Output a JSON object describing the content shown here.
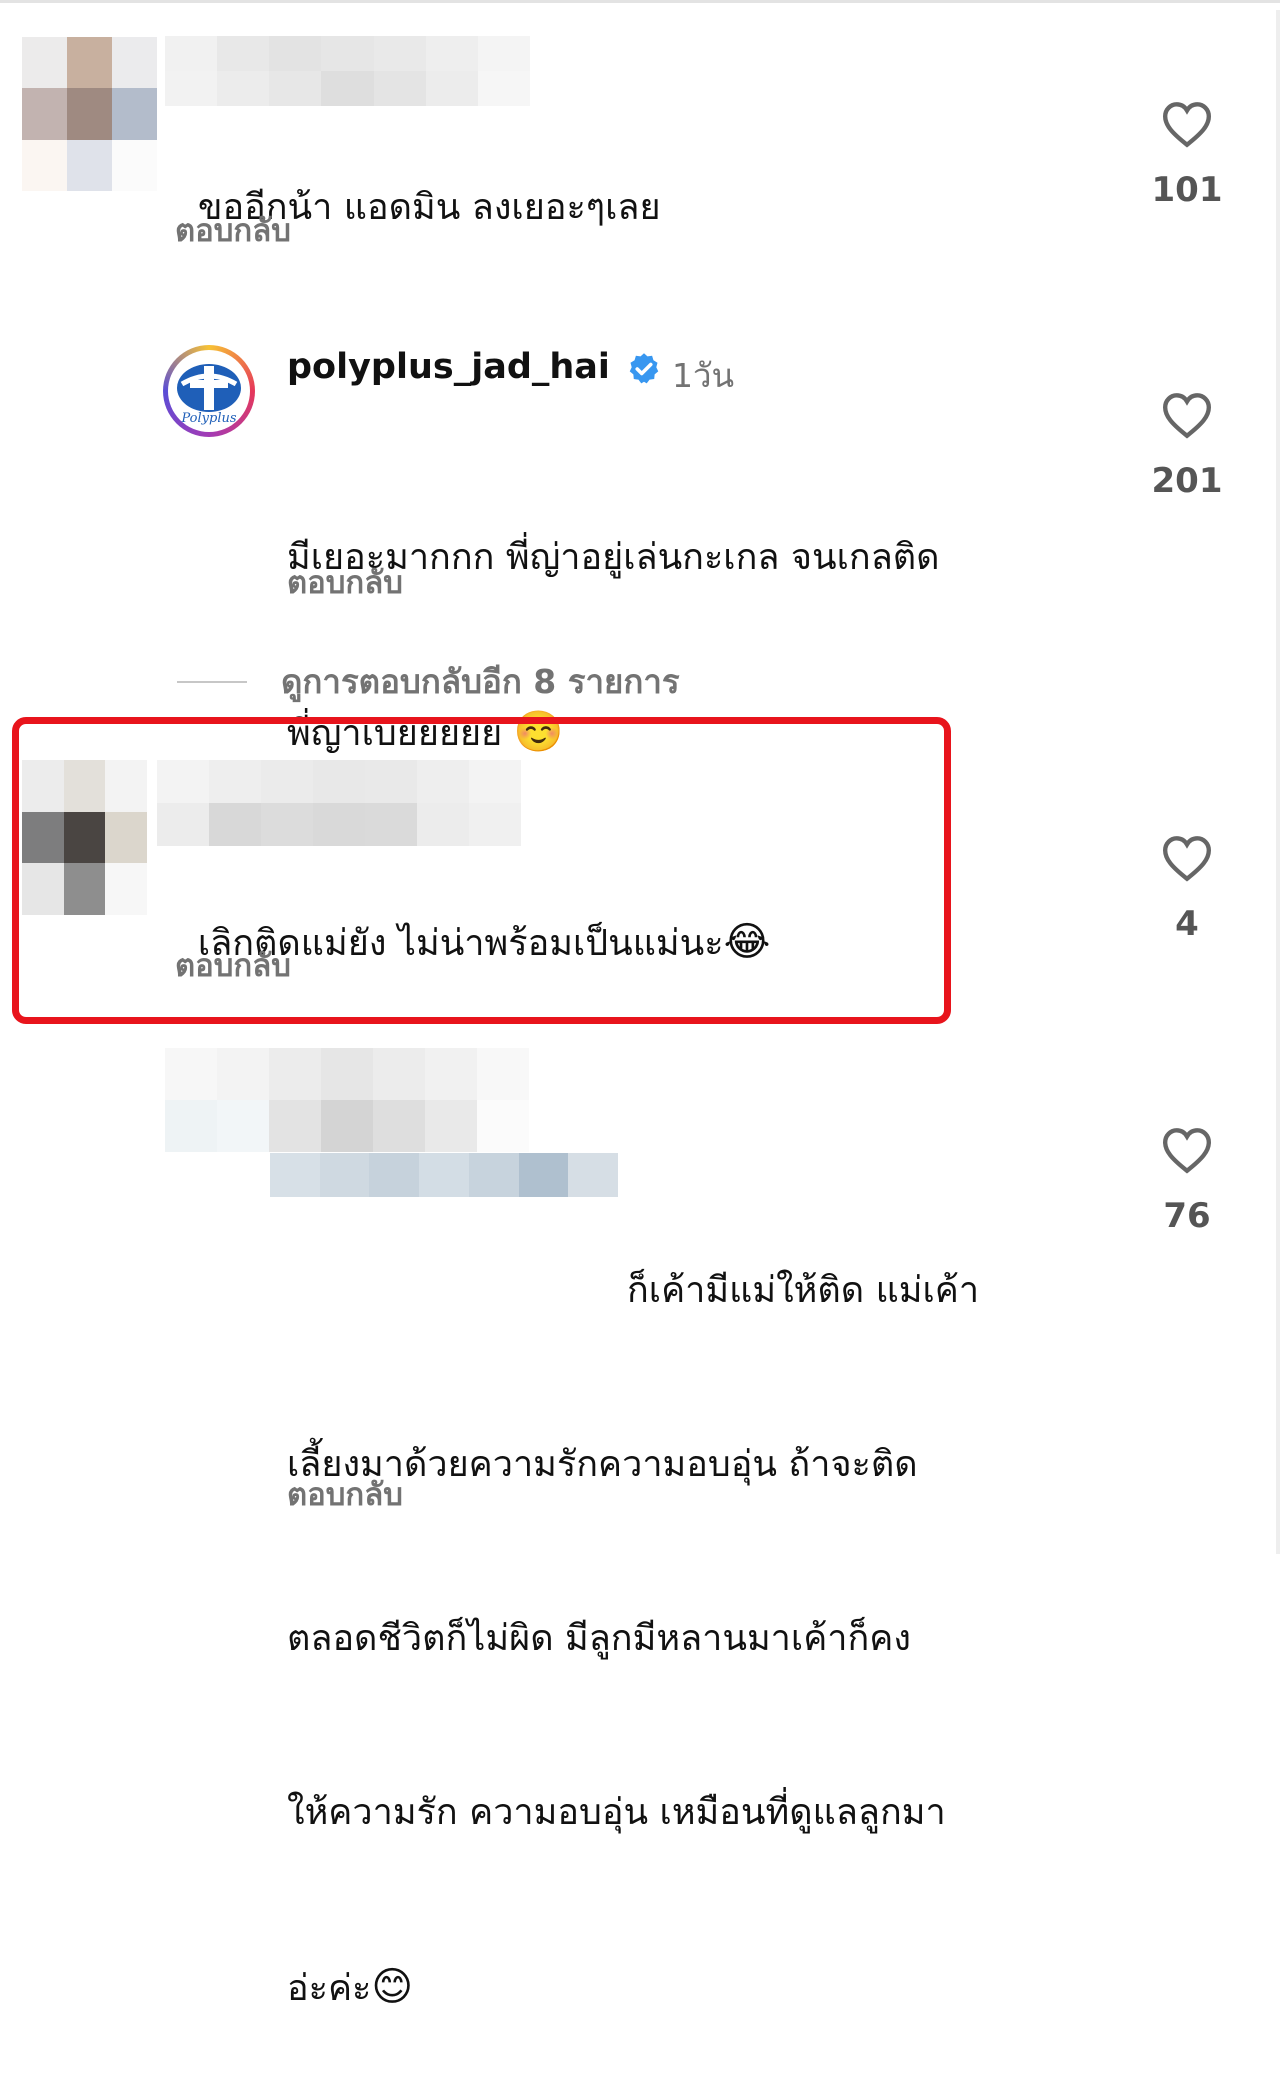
{
  "comments": [
    {
      "text": "ขออีกน้า แอดมิน ลงเยอะๆเลย",
      "reply_label": "ตอบกลับ",
      "likes": "101"
    },
    {
      "username": "polyplus_jad_hai",
      "time": "1วัน",
      "avatar_label": "Polyplus",
      "text_line1": "มีเยอะมากกก พี่ญ่าอยู่เล่นกะเกล จนเกลติด",
      "text_line2": "พี่ญ่าเบยยยยย",
      "emoji": "☺️",
      "reply_label": "ตอบกลับ",
      "likes": "201"
    },
    {
      "text": "เลิกติดแม่ยัง ไม่น่าพร้อมเป็นแม่นะ",
      "emoji": "😂",
      "reply_label": "ตอบกลับ",
      "likes": "4"
    },
    {
      "text_line1": "ก็เค้ามีแม่ให้ติด แม่เค้า",
      "text_line2": "เลี้ยงมาด้วยความรักความอบอุ่น ถ้าจะติด",
      "text_line3": "ตลอดชีวิตก็ไม่ผิด มีลูกมีหลานมาเค้าก็คง",
      "text_line4": "ให้ความรัก ความอบอุ่น เหมือนที่ดูแลลูกมา",
      "text_line5": "อ่ะค่ะ",
      "emoji": "😊",
      "reply_label": "ตอบกลับ",
      "likes": "76"
    }
  ],
  "view_replies": "ดูการตอบกลับอีก 8 รายการ",
  "colors": {
    "highlight": "#e8141c",
    "muted": "#737373",
    "verified": "#3897f0"
  }
}
